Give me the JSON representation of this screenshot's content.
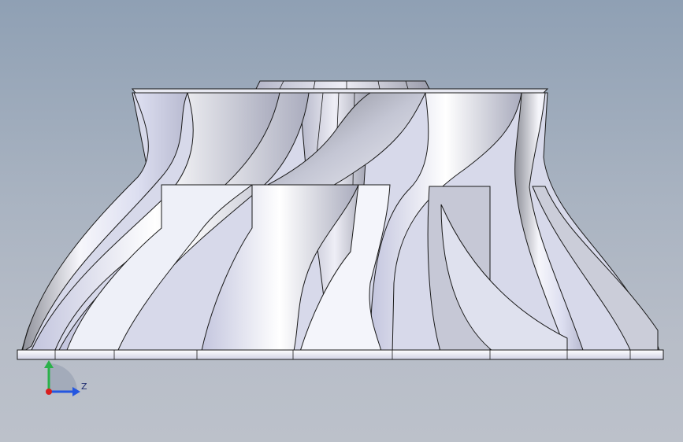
{
  "viewport": {
    "background_top": "#8fa0b4",
    "background_bottom": "#bcc1ca"
  },
  "triad": {
    "axis_z_label": "Z",
    "axis_y_label": "↑",
    "color_y": "#2bb14a",
    "color_z": "#2456e0",
    "color_x": "#d81e1e"
  },
  "model": {
    "icon": "impeller-3d-model",
    "edge_color": "#1a1a1a",
    "face_light": "#f4f5fb",
    "face_mid": "#c9cbe3",
    "face_dark": "#8e9099"
  }
}
